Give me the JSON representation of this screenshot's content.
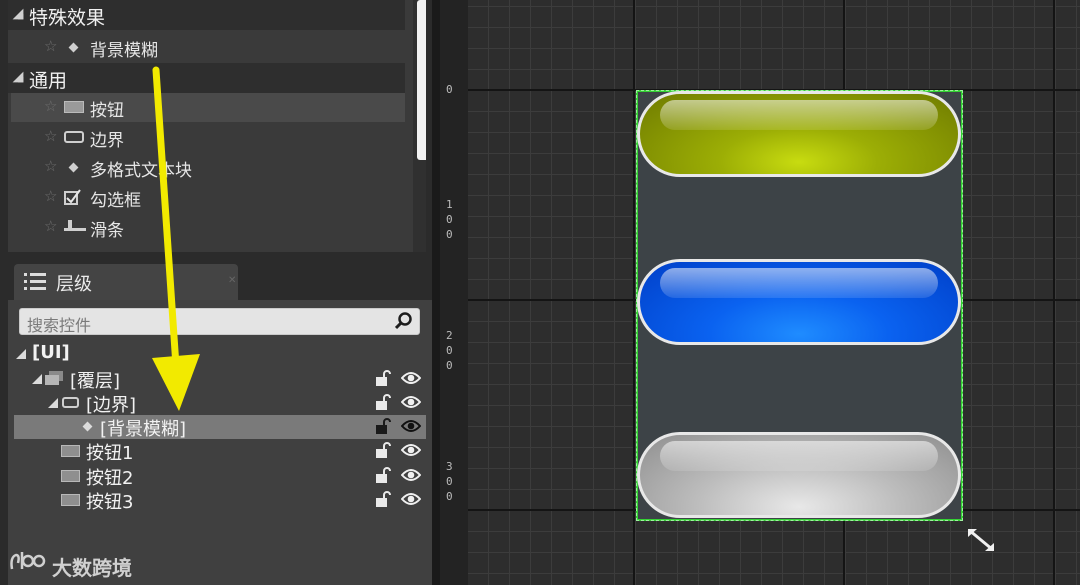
{
  "palette": {
    "categories": [
      {
        "label": "特殊效果"
      },
      {
        "label": "通用"
      }
    ],
    "items": [
      {
        "label": "背景模糊",
        "icon": "diamond-icon"
      },
      {
        "label": "按钮",
        "icon": "button-widget-icon"
      },
      {
        "label": "边界",
        "icon": "border-widget-icon"
      },
      {
        "label": "多格式文本块",
        "icon": "diamond-icon"
      },
      {
        "label": "勾选框",
        "icon": "checkbox-icon"
      },
      {
        "label": "滑条",
        "icon": "slider-icon"
      }
    ]
  },
  "hierarchy": {
    "tab_label": "层级",
    "search_placeholder": "搜索控件",
    "rows": [
      {
        "label": "[UI]"
      },
      {
        "label": "[覆层]"
      },
      {
        "label": "[边界]"
      },
      {
        "label": "[背景模糊]"
      },
      {
        "label": "按钮1"
      },
      {
        "label": "按钮2"
      },
      {
        "label": "按钮3"
      }
    ]
  },
  "canvas": {
    "ruler_labels": [
      {
        "label": "0",
        "digits": [
          "0"
        ]
      },
      {
        "label": "100",
        "digits": [
          "1",
          "0",
          "0"
        ]
      },
      {
        "label": "200",
        "digits": [
          "2",
          "0",
          "0"
        ]
      },
      {
        "label": "300",
        "digits": [
          "3",
          "0",
          "0"
        ]
      }
    ],
    "buttons": [
      {
        "color": "#9cae05"
      },
      {
        "color": "#0a62f0"
      },
      {
        "color": "#bdbdbd"
      }
    ],
    "selection_color": "#35d135",
    "arrow_color": "#f2ea00"
  },
  "watermark": {
    "text": "大数跨境"
  }
}
